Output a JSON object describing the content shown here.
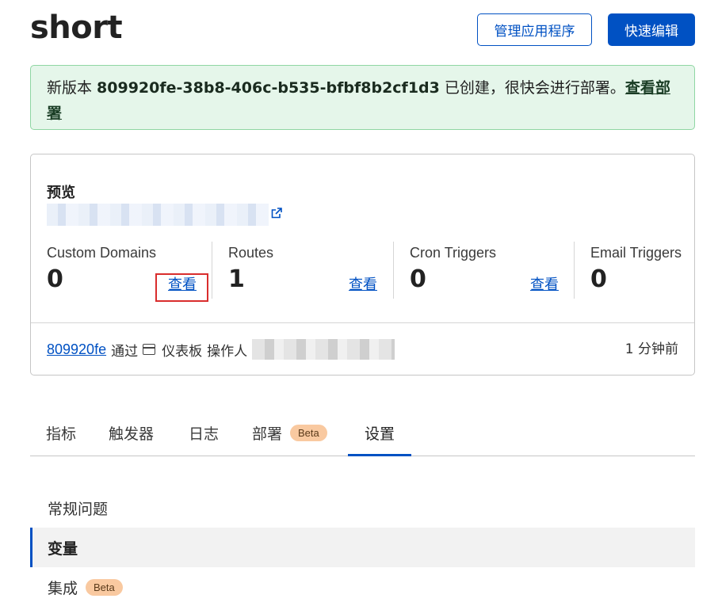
{
  "header": {
    "title": "short",
    "manage_button": "管理应用程序",
    "quick_edit_button": "快速编辑"
  },
  "banner": {
    "prefix": "新版本 ",
    "version_id": "809920fe-38b8-406c-b535-bfbf8b2cf1d3",
    "suffix": " 已创建，很快会进行部署。",
    "link": "查看部署",
    "colors": {
      "background": "#e5f6ea",
      "border": "#8fd6a3"
    }
  },
  "card": {
    "preview_label": "预览",
    "stats": [
      {
        "label": "Custom Domains",
        "value": "0",
        "link": "查看"
      },
      {
        "label": "Routes",
        "value": "1",
        "link": "查看"
      },
      {
        "label": "Cron Triggers",
        "value": "0",
        "link": "查看"
      },
      {
        "label": "Email Triggers",
        "value": "0"
      }
    ],
    "footer": {
      "commit": "809920fe",
      "via": "通过",
      "dashboard": "仪表板",
      "operator_label": "操作人",
      "time": "1 分钟前"
    }
  },
  "tabs": [
    {
      "label": "指标"
    },
    {
      "label": "触发器"
    },
    {
      "label": "日志"
    },
    {
      "label": "部署",
      "badge": "Beta"
    },
    {
      "label": "设置",
      "active": true
    }
  ],
  "settings_nav": [
    {
      "label": "常规问题"
    },
    {
      "label": "变量",
      "active": true
    },
    {
      "label": "集成",
      "badge": "Beta"
    }
  ],
  "colors": {
    "accent": "#0051c3",
    "badge_bg": "#f9c9a0",
    "highlight": "#d92d2d"
  }
}
